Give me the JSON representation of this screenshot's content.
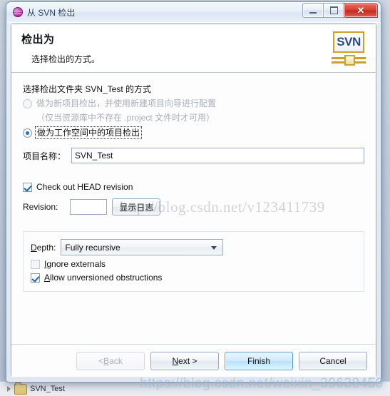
{
  "backdrop": {
    "tree_item_label": "SVN_Test",
    "folder_icon": "folder-icon",
    "arrow_icon": "tree-expand-arrow-icon"
  },
  "window": {
    "title": "从 SVN 检出",
    "icon": "svn-repository-sphere-icon",
    "minimize_glyph": "minimize-icon",
    "maximize_glyph": "maximize-icon",
    "close_glyph": "✕"
  },
  "header": {
    "title": "检出为",
    "subtitle": "选择检出的方式。",
    "logo_text": "SVN",
    "logo_icon": "svn-logo-icon"
  },
  "body": {
    "group_label": "选择检出文件夹 SVN_Test 的方式",
    "radios": [
      {
        "label": "做为新项目检出，并使用新建项目向导进行配置",
        "checked": false,
        "disabled": true
      },
      {
        "label": "做为工作空间中的项目检出",
        "checked": true,
        "disabled": false
      }
    ],
    "hint": "（仅当资源库中不存在 .project 文件时才可用）",
    "project_name": {
      "label": "项目名称：",
      "value": "SVN_Test",
      "placeholder": ""
    },
    "head_revision": {
      "label": "Check out HEAD revision",
      "checked": true
    },
    "revision": {
      "label": "Revision:",
      "value": "",
      "placeholder": "",
      "show_log_button": "显示日志"
    },
    "depth": {
      "label": "Depth:",
      "selected": "Fully recursive",
      "options": [
        "Fully recursive"
      ],
      "arrow_icon": "chevron-down-icon",
      "ignore_externals": {
        "label_prefix": "I",
        "label_rest": "gnore externals",
        "checked": false
      },
      "allow_unversioned": {
        "label_prefix": "A",
        "label_rest": "llow unversioned obstructions",
        "checked": true
      }
    }
  },
  "buttons": {
    "back": {
      "label_prefix": "< ",
      "label_key": "B",
      "label_rest": "ack",
      "disabled": true
    },
    "next": {
      "label_prefix": "",
      "label_key": "N",
      "label_rest": "ext >",
      "disabled": false
    },
    "finish": {
      "label": "Finish",
      "default": true
    },
    "cancel": {
      "label": "Cancel",
      "default": false
    }
  },
  "watermarks": {
    "middle": "http://blog.csdn.net/v123411739",
    "bottom": "https://blog.csdn.net/weixin_39638459"
  },
  "colors": {
    "accent": "#2a6fc9",
    "default_button_border": "#4f9ad1",
    "close_button": "#d93f30",
    "logo_gold": "#c9a227",
    "disabled_text": "#a9b0b8"
  }
}
